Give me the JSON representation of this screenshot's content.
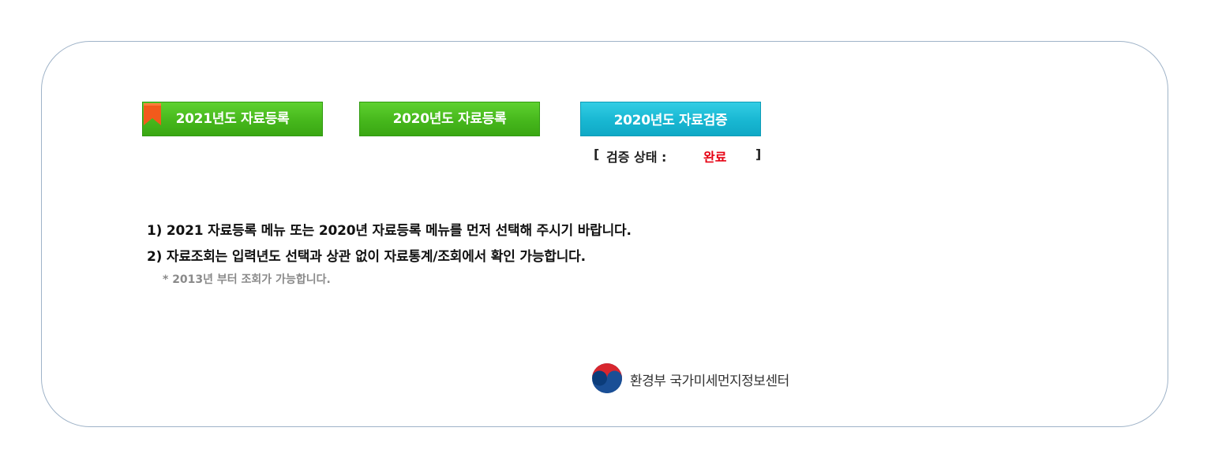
{
  "buttons": {
    "register_2021": "2021년도 자료등록",
    "register_2020": "2020년도 자료등록",
    "verify_2020": "2020년도 자료검증"
  },
  "verification_status": {
    "open": "[",
    "label": "검증 상태 :",
    "value": "완료",
    "close": "]"
  },
  "notices": [
    "1) 2021 자료등록 메뉴 또는 2020년 자료등록 메뉴를 먼저 선택해 주시기 바랍니다.",
    "2) 자료조회는 입력년도 선택과 상관 없이 자료통계/조회에서 확인 가능합니다."
  ],
  "notice_sub": "* 2013년 부터 조회가 가능합니다.",
  "footer": {
    "org": "환경부 국가미세먼지정보센터",
    "logo_icon": "government-emblem-icon"
  },
  "colors": {
    "green_button": "#46b71c",
    "blue_button": "#18b7d2",
    "status_value": "#e60012",
    "bookmark": "#f25a1b"
  }
}
